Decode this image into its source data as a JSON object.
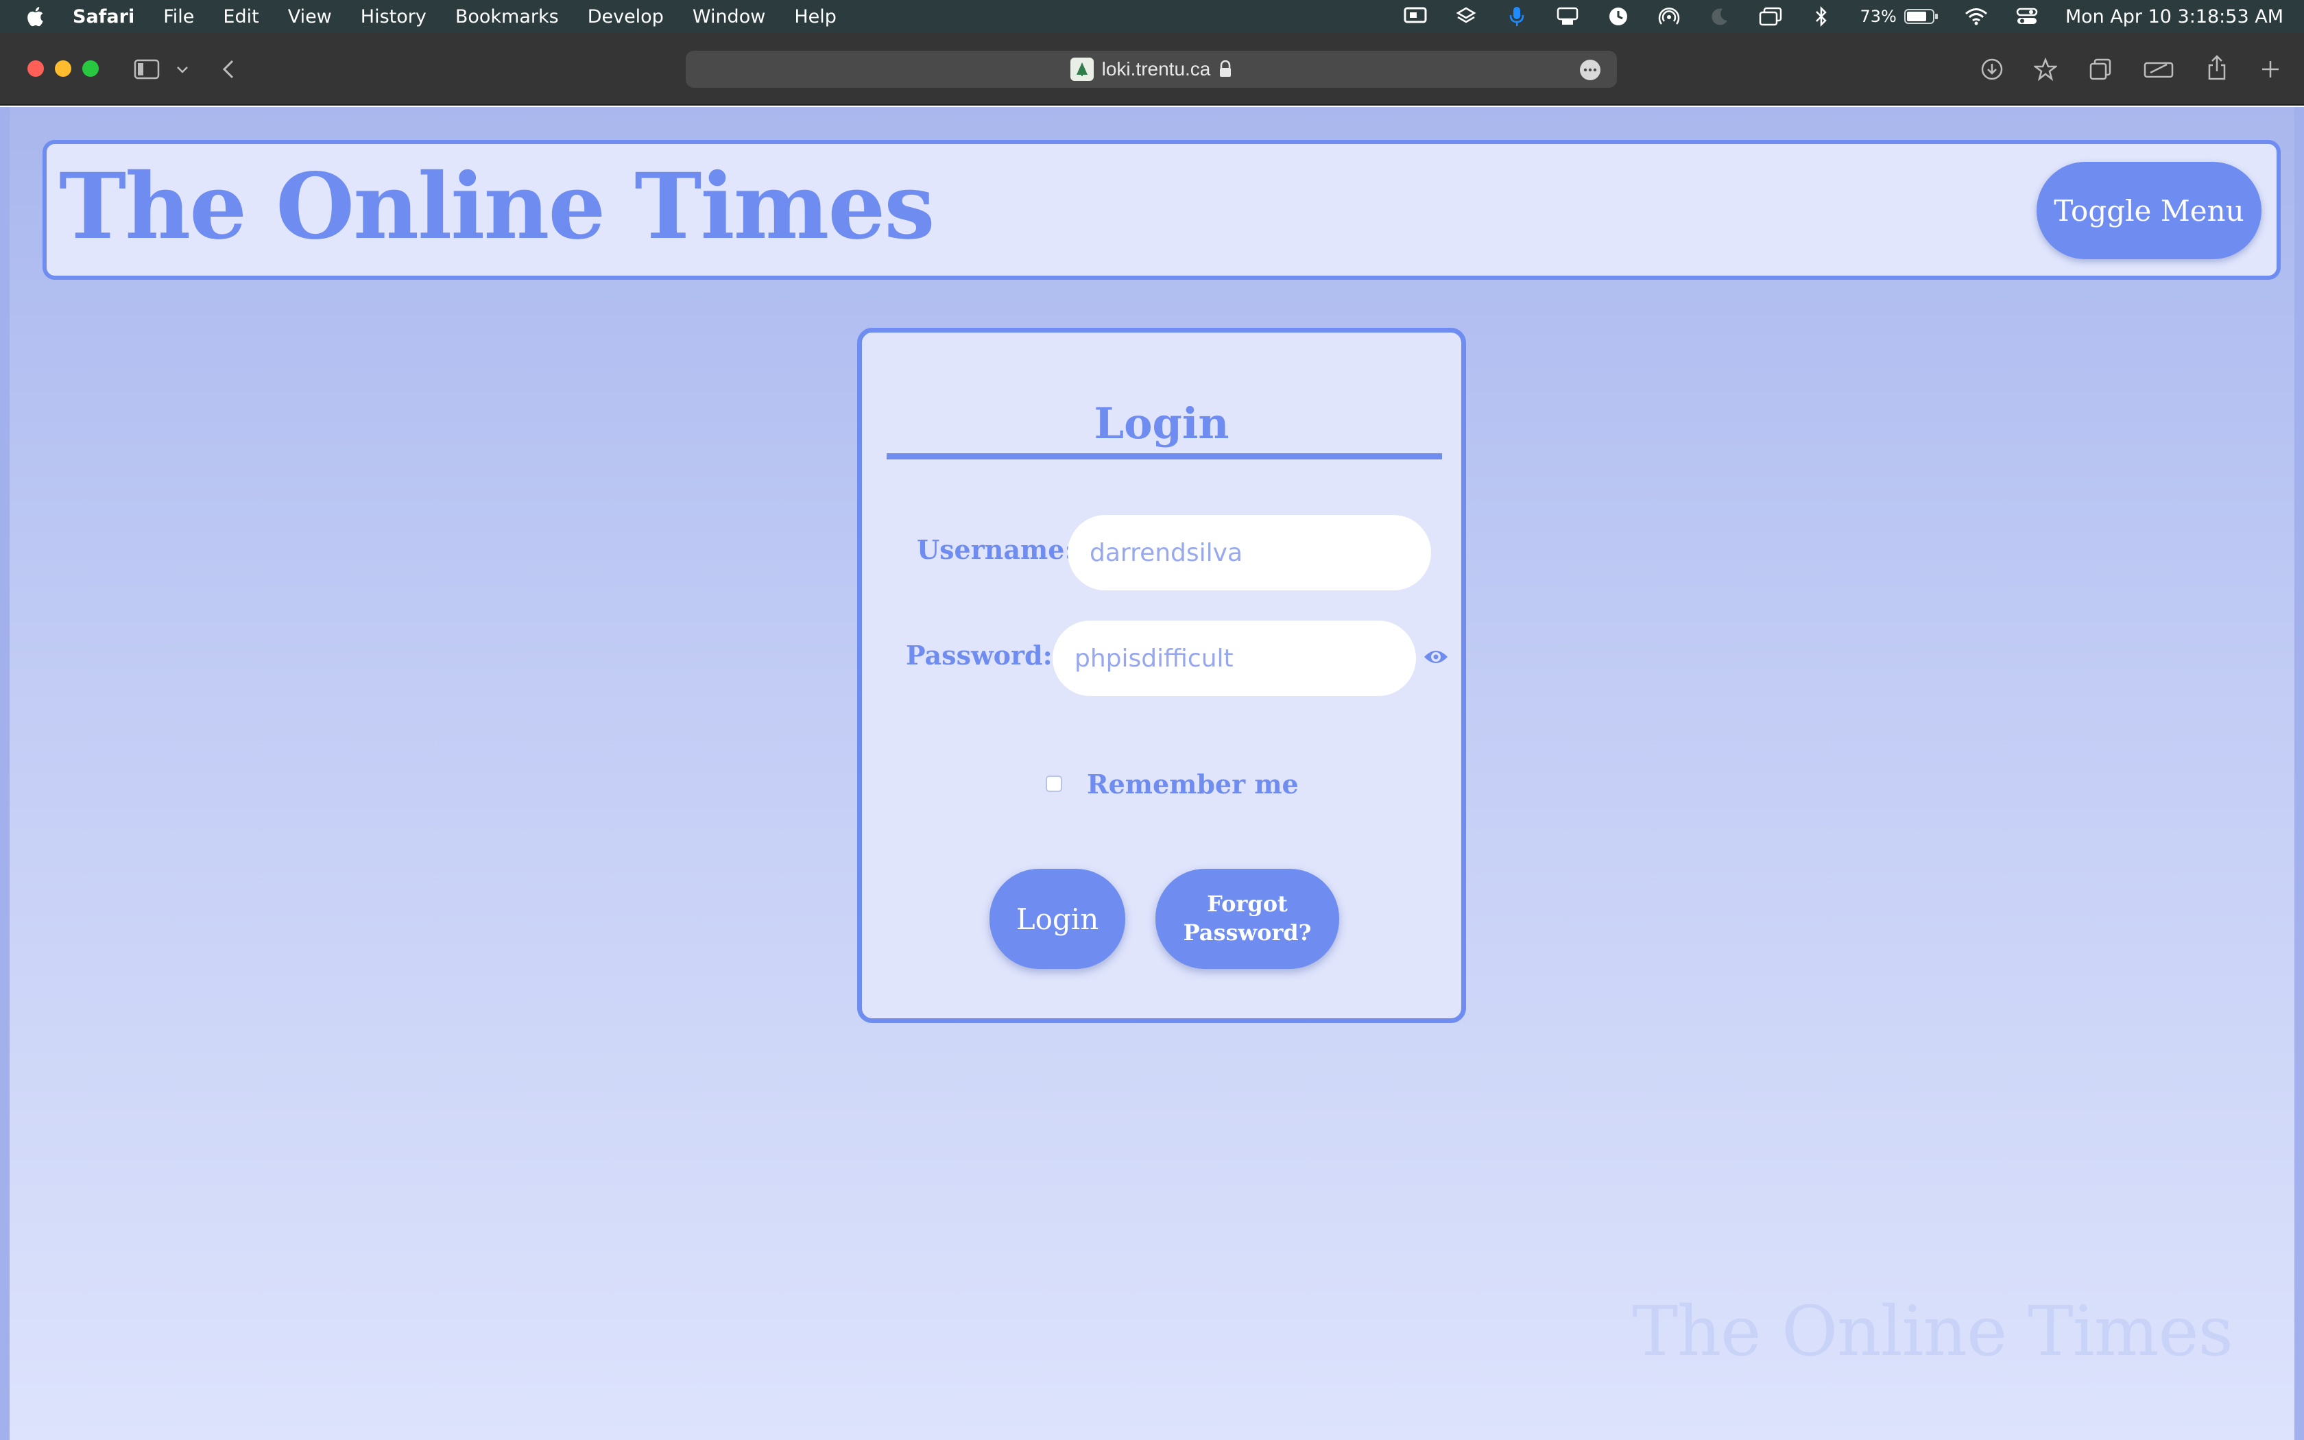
{
  "menubar": {
    "app_name": "Safari",
    "items": [
      "File",
      "Edit",
      "View",
      "History",
      "Bookmarks",
      "Develop",
      "Window",
      "Help"
    ],
    "battery_percent": "73%",
    "datetime": "Mon Apr 10  3:18:53 AM",
    "status_icons": [
      "screen-mirroring-icon",
      "layers-icon",
      "microphone-icon",
      "stream-deck-icon",
      "clock-icon",
      "airdrop-icon",
      "moon-icon",
      "window-icon",
      "bluetooth-icon",
      "battery-icon",
      "wifi-icon",
      "control-center-icon"
    ]
  },
  "browser": {
    "url": "loki.trentu.ca",
    "secure_icon": "lock-icon"
  },
  "site": {
    "title": "The Online Times",
    "toggle_menu_label": "Toggle Menu",
    "watermark": "The Online Times"
  },
  "login": {
    "heading": "Login",
    "username_label": "Username:",
    "username_value": "darrendsilva",
    "password_label": "Password:",
    "password_value": "phpisdifficult",
    "remember_label": "Remember me",
    "login_button": "Login",
    "forgot_button": "Forgot Password?"
  },
  "colors": {
    "accent": "#6f8cf0",
    "card_bg": "#e0e5fc",
    "menubar_bg": "#2b3b3e",
    "toolbar_bg": "#353535"
  }
}
